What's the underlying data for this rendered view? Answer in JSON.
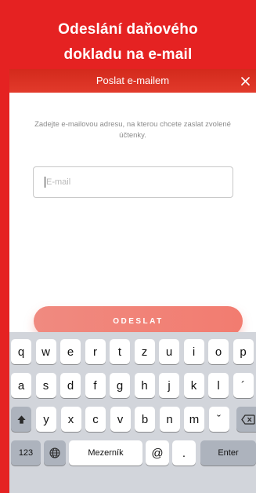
{
  "promo": {
    "title_line1": "Odeslání daňového",
    "title_line2": "dokladu na e-mail"
  },
  "modal": {
    "title": "Poslat e-mailem",
    "close_symbol": "×",
    "instructions": "Zadejte e-mailovou adresu, na kterou chcete zaslat zvolené účtenky.",
    "email_placeholder": "E-mail",
    "email_value": "",
    "send_label": "ODESLAT"
  },
  "keyboard": {
    "row1": [
      "q",
      "w",
      "e",
      "r",
      "t",
      "z",
      "u",
      "i",
      "o",
      "p"
    ],
    "row2": [
      "a",
      "s",
      "d",
      "f",
      "g",
      "h",
      "j",
      "k",
      "l",
      "´"
    ],
    "row3": [
      "y",
      "x",
      "c",
      "v",
      "b",
      "n",
      "m",
      "ˇ"
    ],
    "shift_icon": "shift-icon",
    "delete_icon": "backspace-icon",
    "numbers_label": "123",
    "globe_icon": "globe-icon",
    "space_label": "Mezerník",
    "at_label": "@",
    "dot_label": ".",
    "enter_label": "Enter"
  },
  "colors": {
    "brand_red": "#e52222",
    "header_red": "#d32a1c",
    "button_salmon": "#f08a80",
    "keyboard_bg": "#d2d5db"
  }
}
